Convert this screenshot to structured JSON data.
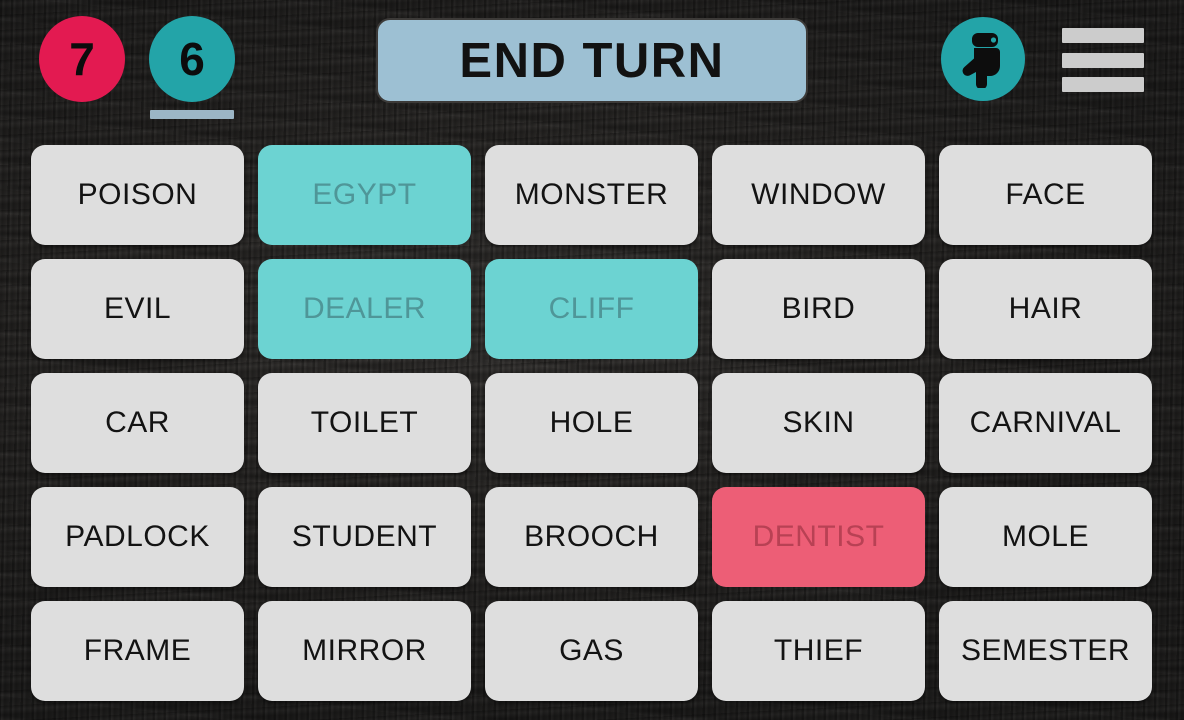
{
  "topbar": {
    "scores": [
      {
        "name": "red-team-score",
        "value": "7",
        "color": "#e31a51",
        "active": false
      },
      {
        "name": "teal-team-score",
        "value": "6",
        "color": "#23a4a8",
        "active": true
      }
    ],
    "end_turn_label": "END TURN",
    "hand_icon": "hand-pointing-down-icon",
    "menu_icon": "hamburger-menu-icon"
  },
  "board": {
    "rows": 5,
    "cols": 5,
    "cards": [
      {
        "label": "POISON",
        "state": "hidden"
      },
      {
        "label": "EGYPT",
        "state": "teal"
      },
      {
        "label": "MONSTER",
        "state": "hidden"
      },
      {
        "label": "WINDOW",
        "state": "hidden"
      },
      {
        "label": "FACE",
        "state": "hidden"
      },
      {
        "label": "EVIL",
        "state": "hidden"
      },
      {
        "label": "DEALER",
        "state": "teal"
      },
      {
        "label": "CLIFF",
        "state": "teal"
      },
      {
        "label": "BIRD",
        "state": "hidden"
      },
      {
        "label": "HAIR",
        "state": "hidden"
      },
      {
        "label": "CAR",
        "state": "hidden"
      },
      {
        "label": "TOILET",
        "state": "hidden"
      },
      {
        "label": "HOLE",
        "state": "hidden"
      },
      {
        "label": "SKIN",
        "state": "hidden"
      },
      {
        "label": "CARNIVAL",
        "state": "hidden"
      },
      {
        "label": "PADLOCK",
        "state": "hidden"
      },
      {
        "label": "STUDENT",
        "state": "hidden"
      },
      {
        "label": "BROOCH",
        "state": "hidden"
      },
      {
        "label": "DENTIST",
        "state": "red"
      },
      {
        "label": "MOLE",
        "state": "hidden"
      },
      {
        "label": "FRAME",
        "state": "hidden"
      },
      {
        "label": "MIRROR",
        "state": "hidden"
      },
      {
        "label": "GAS",
        "state": "hidden"
      },
      {
        "label": "THIEF",
        "state": "hidden"
      },
      {
        "label": "SEMESTER",
        "state": "hidden"
      }
    ]
  },
  "colors": {
    "red_team": "#e31a51",
    "teal_team": "#23a4a8",
    "revealed_teal": "#6cd3d2",
    "revealed_red": "#ed5e76",
    "hidden_card": "#dedede",
    "accent_bar": "#9cb6c6",
    "background": "#2b2927"
  }
}
